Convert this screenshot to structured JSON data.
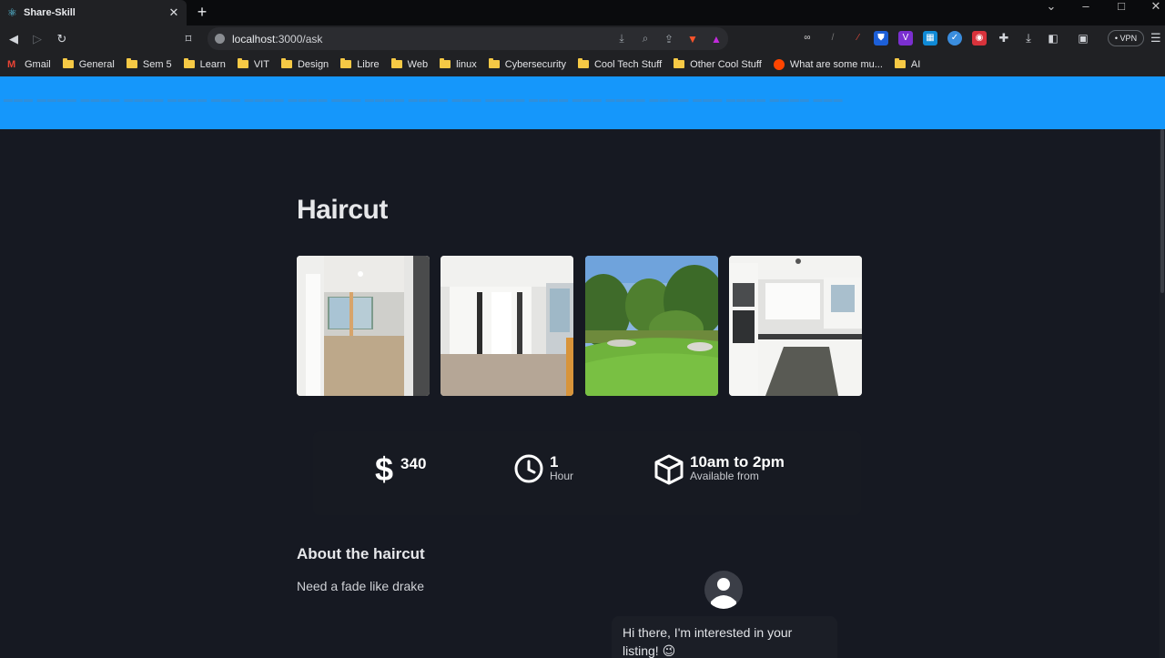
{
  "browser": {
    "tab_title": "Share-Skill",
    "tab_close": "✕",
    "new_tab": "+",
    "url_host": "localhost",
    "url_path": ":3000/ask",
    "vpn_label": "• VPN",
    "bookmarks": [
      {
        "label": "Gmail",
        "icon": "gmail-icon"
      },
      {
        "label": "General",
        "icon": "folder-icon"
      },
      {
        "label": "Sem 5",
        "icon": "folder-icon"
      },
      {
        "label": "Learn",
        "icon": "folder-icon"
      },
      {
        "label": "VIT",
        "icon": "folder-icon"
      },
      {
        "label": "Design",
        "icon": "folder-icon"
      },
      {
        "label": "Libre",
        "icon": "folder-icon"
      },
      {
        "label": "Web",
        "icon": "folder-icon"
      },
      {
        "label": "linux",
        "icon": "folder-icon"
      },
      {
        "label": "Cybersecurity",
        "icon": "folder-icon"
      },
      {
        "label": "Cool Tech Stuff",
        "icon": "folder-icon"
      },
      {
        "label": "Other Cool Stuff",
        "icon": "folder-icon"
      },
      {
        "label": "What are some mu...",
        "icon": "reddit-icon"
      },
      {
        "label": "AI",
        "icon": "folder-icon"
      }
    ]
  },
  "listing": {
    "title": "Haircut",
    "price": "340",
    "duration_value": "1",
    "duration_unit": "Hour",
    "availability": "10am to 2pm",
    "availability_label": "Available from",
    "about_title": "About the haircut",
    "about_text": "Need a fade like drake"
  },
  "chat": {
    "message": "Hi there, I'm interested in your listing! 😉"
  },
  "colors": {
    "banner": "#1597fb",
    "page_bg": "#161922",
    "text": "#e6e7ea"
  }
}
